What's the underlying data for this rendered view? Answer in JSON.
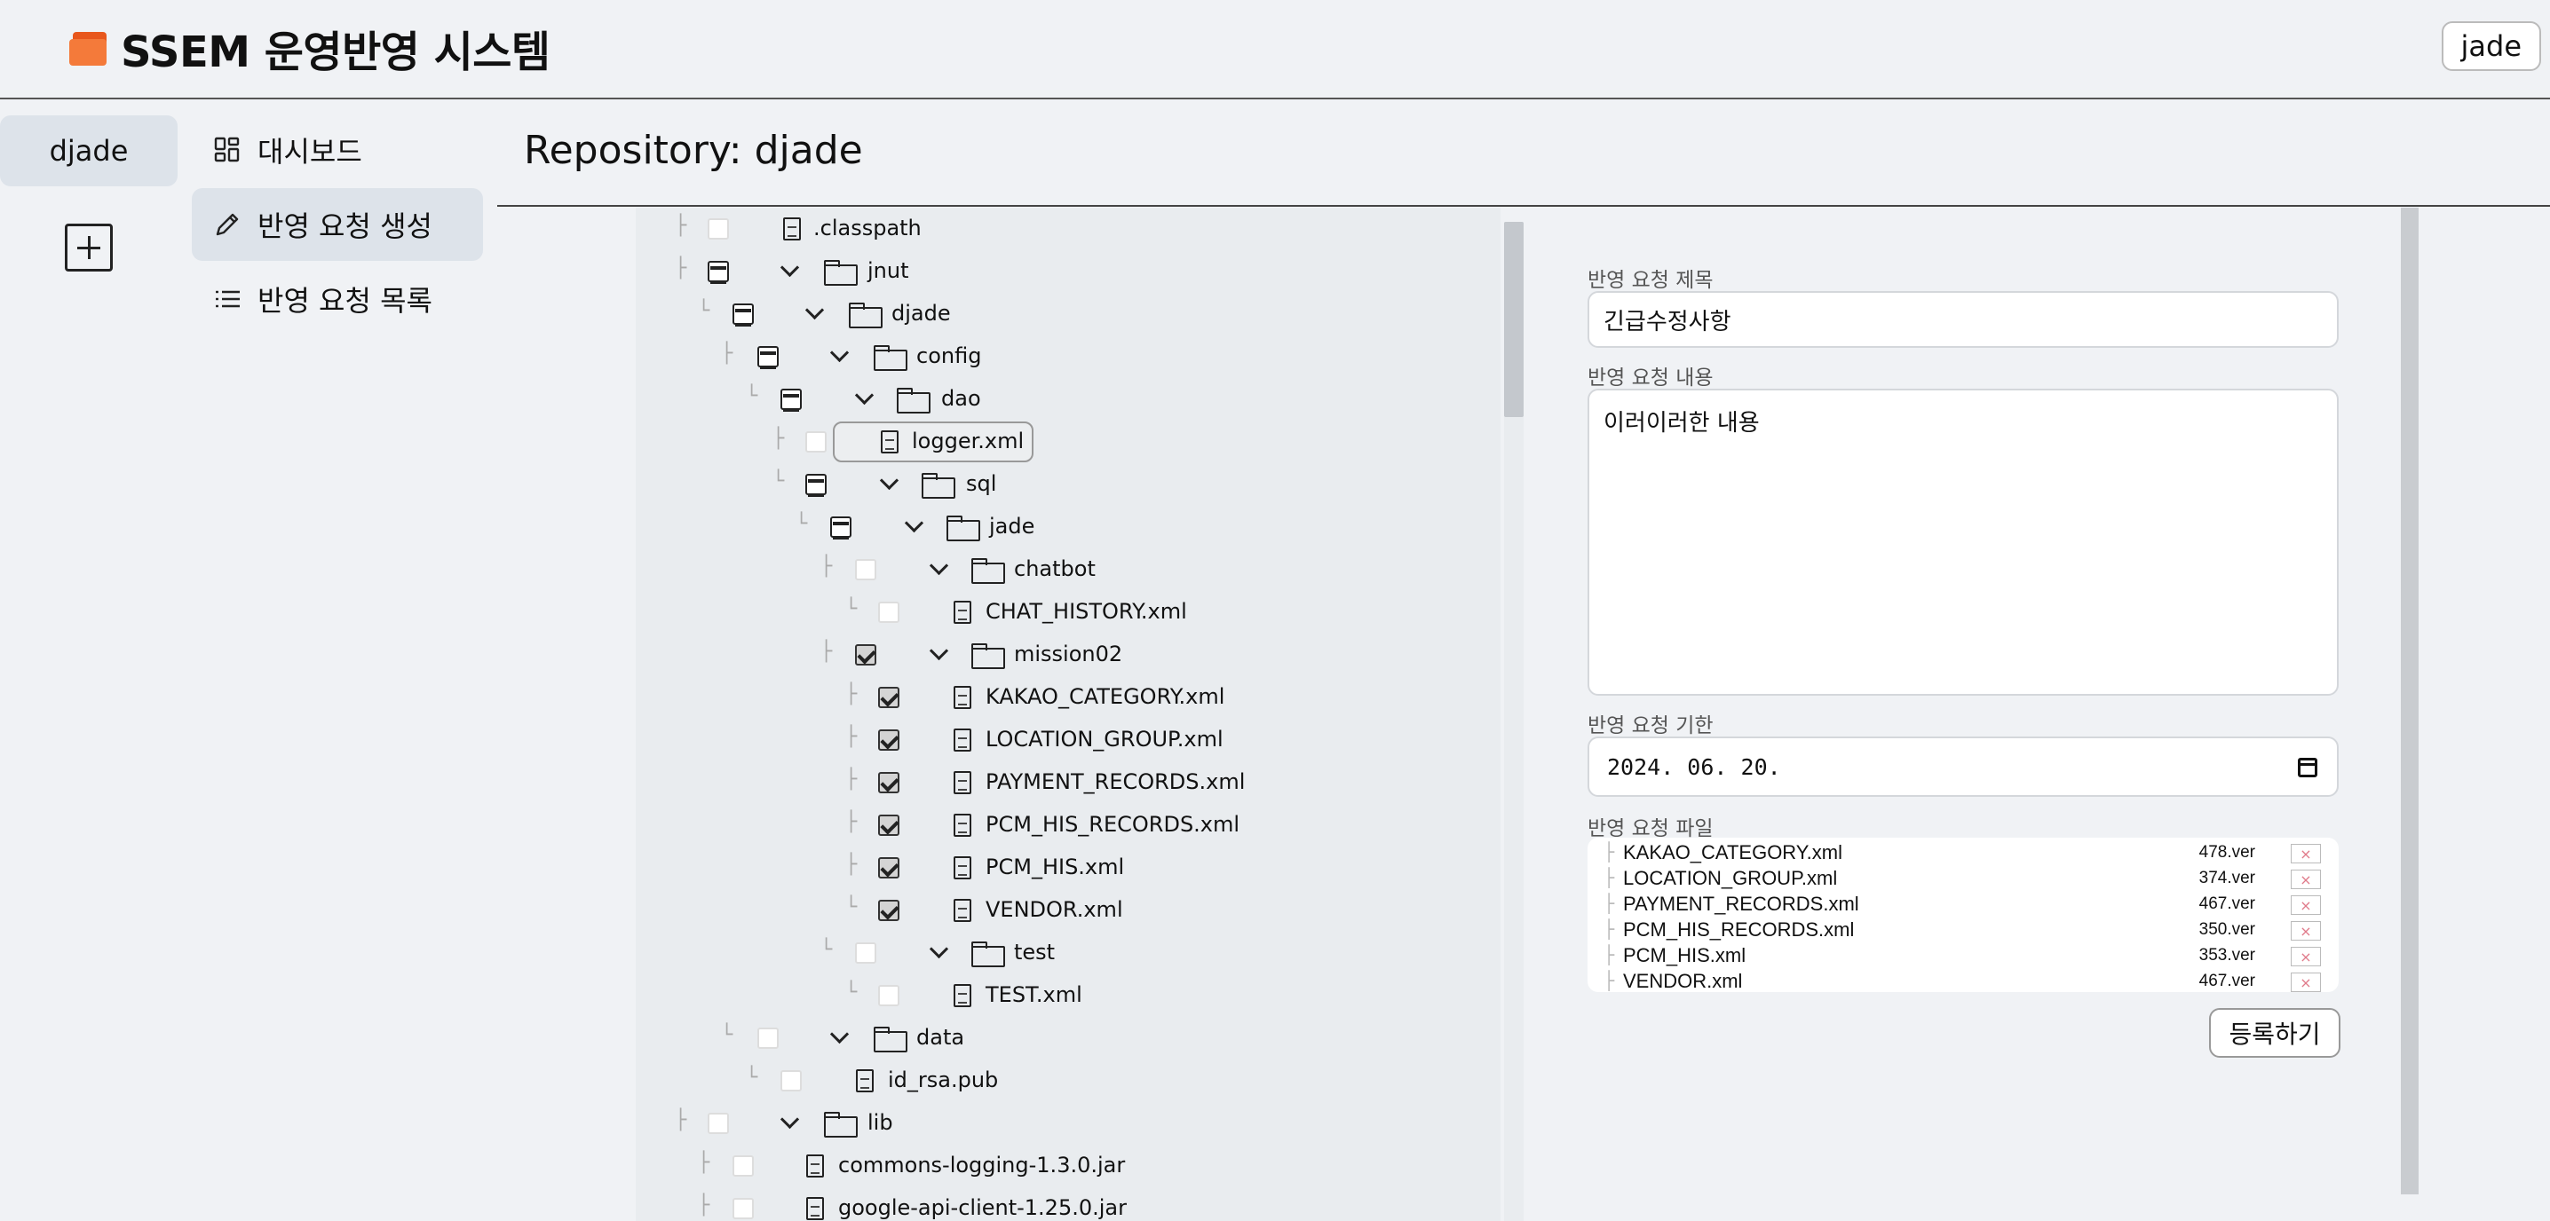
{
  "app": {
    "title": "SSEM 운영반영 시스템",
    "user": "jade"
  },
  "rail": {
    "repo": "djade"
  },
  "nav": {
    "items": [
      {
        "label": "대시보드",
        "icon": "dashboard-icon"
      },
      {
        "label": "반영 요청 생성",
        "icon": "pencil-icon"
      },
      {
        "label": "반영 요청 목록",
        "icon": "list-icon"
      }
    ]
  },
  "main": {
    "title": "Repository: djade"
  },
  "tree": {
    "rows": [
      {
        "name": ".classpath",
        "type": "file",
        "state": "unchecked"
      },
      {
        "name": "jnut",
        "type": "folder",
        "state": "partial"
      },
      {
        "name": "djade",
        "type": "folder",
        "state": "partial"
      },
      {
        "name": "config",
        "type": "folder",
        "state": "partial"
      },
      {
        "name": "dao",
        "type": "folder",
        "state": "partial"
      },
      {
        "name": "logger.xml",
        "type": "file",
        "state": "unchecked",
        "selected": true
      },
      {
        "name": "sql",
        "type": "folder",
        "state": "partial"
      },
      {
        "name": "jade",
        "type": "folder",
        "state": "partial"
      },
      {
        "name": "chatbot",
        "type": "folder",
        "state": "unchecked"
      },
      {
        "name": "CHAT_HISTORY.xml",
        "type": "file",
        "state": "unchecked"
      },
      {
        "name": "mission02",
        "type": "folder",
        "state": "checked"
      },
      {
        "name": "KAKAO_CATEGORY.xml",
        "type": "file",
        "state": "checked"
      },
      {
        "name": "LOCATION_GROUP.xml",
        "type": "file",
        "state": "checked"
      },
      {
        "name": "PAYMENT_RECORDS.xml",
        "type": "file",
        "state": "checked"
      },
      {
        "name": "PCM_HIS_RECORDS.xml",
        "type": "file",
        "state": "checked"
      },
      {
        "name": "PCM_HIS.xml",
        "type": "file",
        "state": "checked"
      },
      {
        "name": "VENDOR.xml",
        "type": "file",
        "state": "checked"
      },
      {
        "name": "test",
        "type": "folder",
        "state": "unchecked"
      },
      {
        "name": "TEST.xml",
        "type": "file",
        "state": "unchecked"
      },
      {
        "name": "data",
        "type": "folder",
        "state": "unchecked"
      },
      {
        "name": "id_rsa.pub",
        "type": "file",
        "state": "unchecked"
      },
      {
        "name": "lib",
        "type": "folder",
        "state": "unchecked"
      },
      {
        "name": "commons-logging-1.3.0.jar",
        "type": "file",
        "state": "unchecked"
      },
      {
        "name": "google-api-client-1.25.0.jar",
        "type": "file",
        "state": "unchecked"
      }
    ]
  },
  "form": {
    "title_label": "반영 요청 제목",
    "title_value": "긴급수정사항",
    "content_label": "반영 요청 내용",
    "content_value": "이러이러한 내용",
    "due_label": "반영 요청 기한",
    "due_value": "2024. 06. 20.",
    "files_label": "반영 요청 파일",
    "files": [
      {
        "name": "KAKAO_CATEGORY.xml",
        "version": "478.ver"
      },
      {
        "name": "LOCATION_GROUP.xml",
        "version": "374.ver"
      },
      {
        "name": "PAYMENT_RECORDS.xml",
        "version": "467.ver"
      },
      {
        "name": "PCM_HIS_RECORDS.xml",
        "version": "350.ver"
      },
      {
        "name": "PCM_HIS.xml",
        "version": "353.ver"
      },
      {
        "name": "VENDOR.xml",
        "version": "467.ver"
      }
    ],
    "remove_glyph": "×",
    "submit_label": "등록하기"
  }
}
